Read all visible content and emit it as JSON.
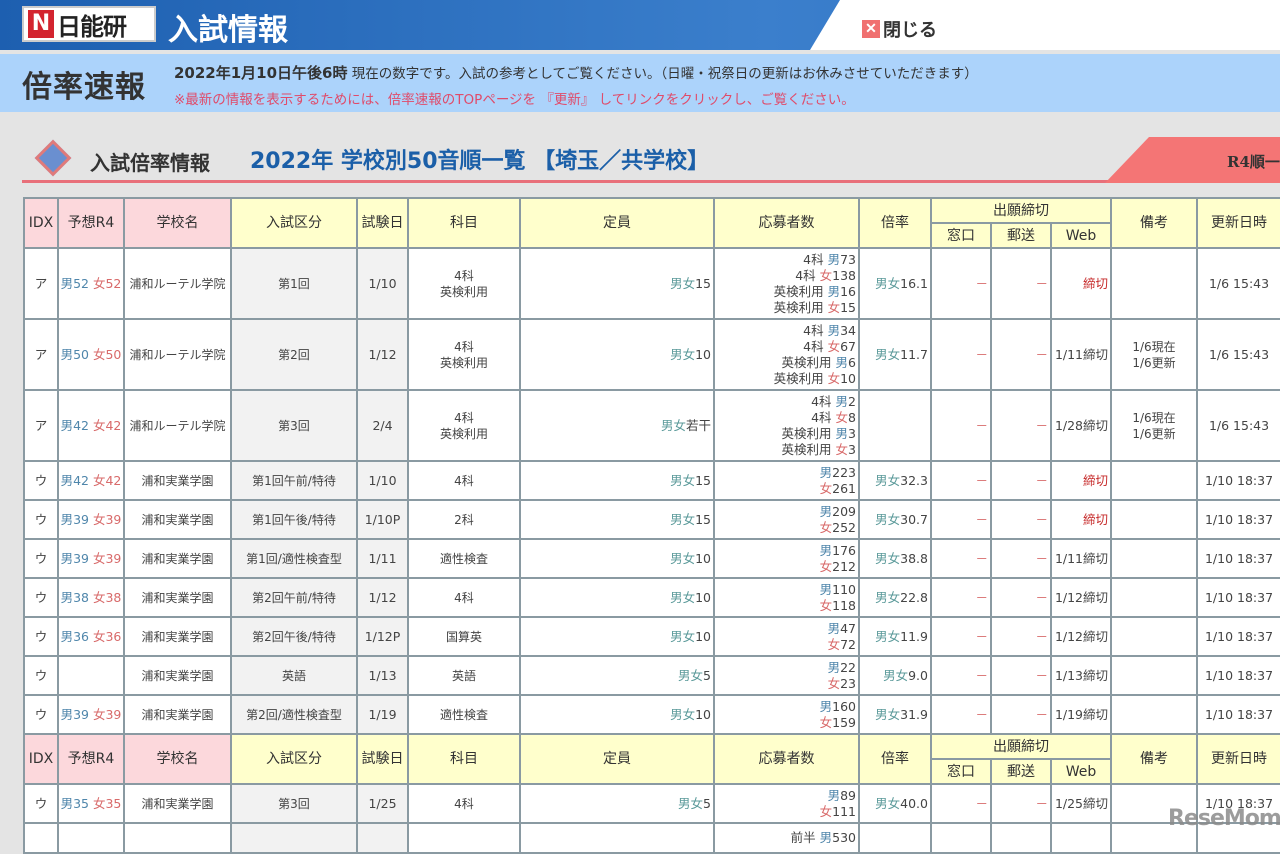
{
  "banner": {
    "logo_mark": "N",
    "logo_text": "日能研",
    "title": "入試情報",
    "close_label": "閉じる"
  },
  "info": {
    "label": "倍率速報",
    "datetime": "2022年1月10日午後6時",
    "line1": "現在の数字です。入試の参考としてご覧ください。（日曜・祝祭日の更新はお休みさせていただきます）",
    "line2": "※最新の情報を表示するためには、倍率速報のTOPページを 『更新』 してリンクをクリックし、ご覧ください。"
  },
  "heading": {
    "label": "入試倍率情報",
    "title": "2022年 学校別50音順一覧 【埼玉／共学校】",
    "ribbon": "R4順一"
  },
  "headers": {
    "idx": "IDX",
    "yoso": "予想R4",
    "school": "学校名",
    "kubun": "入試区分",
    "date": "試験日",
    "subject": "科目",
    "teiin": "定員",
    "applicants": "応募者数",
    "ratio": "倍率",
    "deadline": "出願締切",
    "madoguchi": "窓口",
    "yuso": "郵送",
    "web": "Web",
    "biko": "備考",
    "updated": "更新日時"
  },
  "colors": {
    "male": "#4f86ab",
    "female": "#d86a6a",
    "both": "#5b9a9a",
    "closed": "#c62a2a"
  },
  "rows": [
    {
      "idx": "ア",
      "m": "男52",
      "f": "女52",
      "school": "浦和ルーテル学院",
      "kubun": "第1回",
      "date": "1/10",
      "subject": [
        "4科",
        "英検利用"
      ],
      "teiin_sex": "男女",
      "teiin": "15",
      "apps": [
        [
          "4科 ",
          "男",
          "73"
        ],
        [
          "4科 ",
          "女",
          "138"
        ],
        [
          "英検利用 ",
          "男",
          "16"
        ],
        [
          "英検利用 ",
          "女",
          "15"
        ]
      ],
      "ratio_sex": "男女",
      "ratio": "16.1",
      "madoguchi": "－",
      "yuso": "－",
      "web": "締切",
      "web_closed": true,
      "biko": [],
      "updated": "1/6 15:43"
    },
    {
      "idx": "ア",
      "m": "男50",
      "f": "女50",
      "school": "浦和ルーテル学院",
      "kubun": "第2回",
      "date": "1/12",
      "subject": [
        "4科",
        "英検利用"
      ],
      "teiin_sex": "男女",
      "teiin": "10",
      "apps": [
        [
          "4科 ",
          "男",
          "34"
        ],
        [
          "4科 ",
          "女",
          "67"
        ],
        [
          "英検利用 ",
          "男",
          "6"
        ],
        [
          "英検利用 ",
          "女",
          "10"
        ]
      ],
      "ratio_sex": "男女",
      "ratio": "11.7",
      "madoguchi": "－",
      "yuso": "－",
      "web": "1/11締切",
      "biko": [
        "1/6現在",
        "1/6更新"
      ],
      "updated": "1/6 15:43"
    },
    {
      "idx": "ア",
      "m": "男42",
      "f": "女42",
      "school": "浦和ルーテル学院",
      "kubun": "第3回",
      "date": "2/4",
      "subject": [
        "4科",
        "英検利用"
      ],
      "teiin_sex": "男女",
      "teiin": "若干",
      "apps": [
        [
          "4科 ",
          "男",
          "2"
        ],
        [
          "4科 ",
          "女",
          "8"
        ],
        [
          "英検利用 ",
          "男",
          "3"
        ],
        [
          "英検利用 ",
          "女",
          "3"
        ]
      ],
      "ratio_sex": "",
      "ratio": "",
      "madoguchi": "－",
      "yuso": "－",
      "web": "1/28締切",
      "biko": [
        "1/6現在",
        "1/6更新"
      ],
      "updated": "1/6 15:43"
    },
    {
      "idx": "ウ",
      "m": "男42",
      "f": "女42",
      "school": "浦和実業学園",
      "kubun": "第1回午前/特待",
      "date": "1/10",
      "subject": [
        "4科"
      ],
      "teiin_sex": "男女",
      "teiin": "15",
      "apps": [
        [
          "",
          "男",
          "223"
        ],
        [
          "",
          "女",
          "261"
        ]
      ],
      "ratio_sex": "男女",
      "ratio": "32.3",
      "madoguchi": "－",
      "yuso": "－",
      "web": "締切",
      "web_closed": true,
      "biko": [],
      "updated": "1/10 18:37"
    },
    {
      "idx": "ウ",
      "m": "男39",
      "f": "女39",
      "school": "浦和実業学園",
      "kubun": "第1回午後/特待",
      "date": "1/10P",
      "subject": [
        "2科"
      ],
      "teiin_sex": "男女",
      "teiin": "15",
      "apps": [
        [
          "",
          "男",
          "209"
        ],
        [
          "",
          "女",
          "252"
        ]
      ],
      "ratio_sex": "男女",
      "ratio": "30.7",
      "madoguchi": "－",
      "yuso": "－",
      "web": "締切",
      "web_closed": true,
      "biko": [],
      "updated": "1/10 18:37"
    },
    {
      "idx": "ウ",
      "m": "男39",
      "f": "女39",
      "school": "浦和実業学園",
      "kubun": "第1回/適性検査型",
      "date": "1/11",
      "subject": [
        "適性検査"
      ],
      "teiin_sex": "男女",
      "teiin": "10",
      "apps": [
        [
          "",
          "男",
          "176"
        ],
        [
          "",
          "女",
          "212"
        ]
      ],
      "ratio_sex": "男女",
      "ratio": "38.8",
      "madoguchi": "－",
      "yuso": "－",
      "web": "1/11締切",
      "biko": [],
      "updated": "1/10 18:37"
    },
    {
      "idx": "ウ",
      "m": "男38",
      "f": "女38",
      "school": "浦和実業学園",
      "kubun": "第2回午前/特待",
      "date": "1/12",
      "subject": [
        "4科"
      ],
      "teiin_sex": "男女",
      "teiin": "10",
      "apps": [
        [
          "",
          "男",
          "110"
        ],
        [
          "",
          "女",
          "118"
        ]
      ],
      "ratio_sex": "男女",
      "ratio": "22.8",
      "madoguchi": "－",
      "yuso": "－",
      "web": "1/12締切",
      "biko": [],
      "updated": "1/10 18:37"
    },
    {
      "idx": "ウ",
      "m": "男36",
      "f": "女36",
      "school": "浦和実業学園",
      "kubun": "第2回午後/特待",
      "date": "1/12P",
      "subject": [
        "国算英"
      ],
      "teiin_sex": "男女",
      "teiin": "10",
      "apps": [
        [
          "",
          "男",
          "47"
        ],
        [
          "",
          "女",
          "72"
        ]
      ],
      "ratio_sex": "男女",
      "ratio": "11.9",
      "madoguchi": "－",
      "yuso": "－",
      "web": "1/12締切",
      "biko": [],
      "updated": "1/10 18:37"
    },
    {
      "idx": "ウ",
      "m": "",
      "f": "",
      "school": "浦和実業学園",
      "kubun": "英語",
      "date": "1/13",
      "subject": [
        "英語"
      ],
      "teiin_sex": "男女",
      "teiin": "5",
      "apps": [
        [
          "",
          "男",
          "22"
        ],
        [
          "",
          "女",
          "23"
        ]
      ],
      "ratio_sex": "男女",
      "ratio": "9.0",
      "madoguchi": "－",
      "yuso": "－",
      "web": "1/13締切",
      "biko": [],
      "updated": "1/10 18:37"
    },
    {
      "idx": "ウ",
      "m": "男39",
      "f": "女39",
      "school": "浦和実業学園",
      "kubun": "第2回/適性検査型",
      "date": "1/19",
      "subject": [
        "適性検査"
      ],
      "teiin_sex": "男女",
      "teiin": "10",
      "apps": [
        [
          "",
          "男",
          "160"
        ],
        [
          "",
          "女",
          "159"
        ]
      ],
      "ratio_sex": "男女",
      "ratio": "31.9",
      "madoguchi": "－",
      "yuso": "－",
      "web": "1/19締切",
      "biko": [],
      "updated": "1/10 18:37"
    },
    {
      "header": true
    },
    {
      "idx": "ウ",
      "m": "男35",
      "f": "女35",
      "school": "浦和実業学園",
      "kubun": "第3回",
      "date": "1/25",
      "subject": [
        "4科"
      ],
      "teiin_sex": "男女",
      "teiin": "5",
      "apps": [
        [
          "",
          "男",
          "89"
        ],
        [
          "",
          "女",
          "111"
        ]
      ],
      "ratio_sex": "男女",
      "ratio": "40.0",
      "madoguchi": "－",
      "yuso": "－",
      "web": "1/25締切",
      "biko": [],
      "updated": "1/10 18:37"
    },
    {
      "idx": "",
      "m": "",
      "f": "",
      "school": "",
      "kubun": "",
      "date": "",
      "subject": [],
      "teiin_sex": "",
      "teiin": "",
      "apps": [
        [
          "前半 ",
          "男",
          "530"
        ]
      ],
      "ratio_sex": "",
      "ratio": "",
      "madoguchi": "",
      "yuso": "",
      "web": "",
      "biko": [],
      "updated": "",
      "partial": true
    }
  ],
  "watermark": "ReseMom"
}
